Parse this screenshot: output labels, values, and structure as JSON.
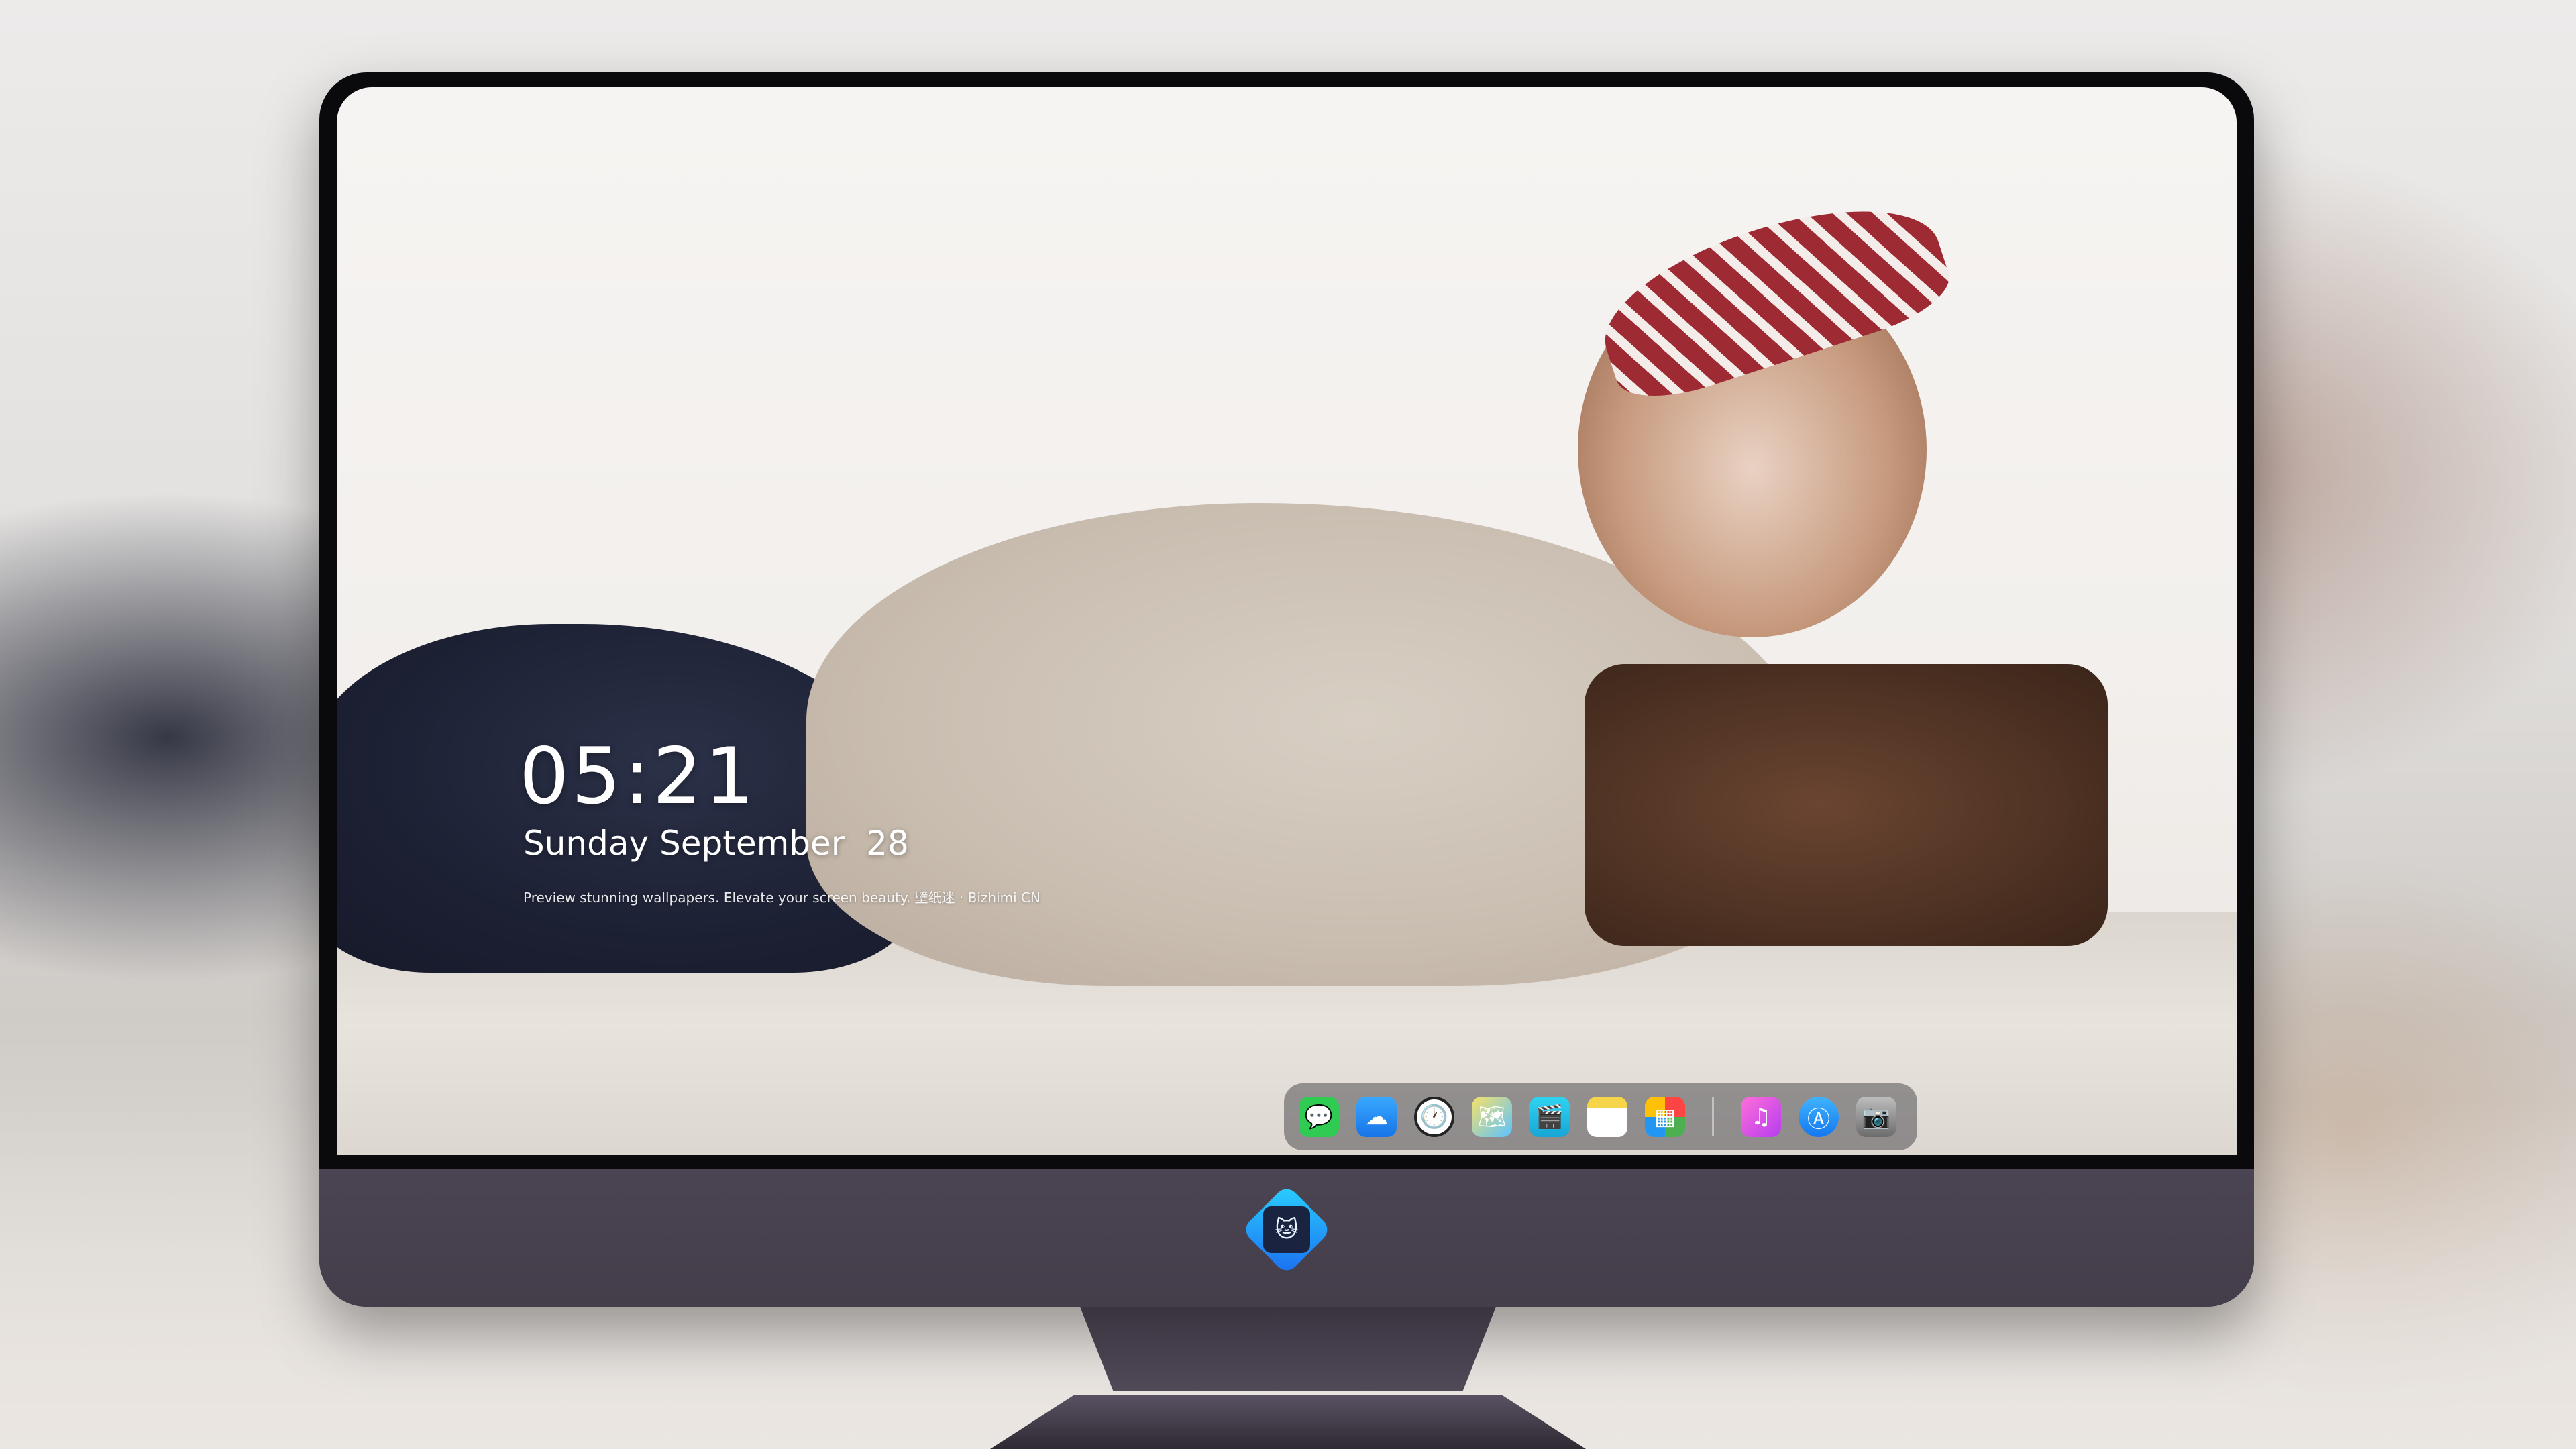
{
  "lockscreen": {
    "time": "05:21",
    "date": "Sunday September  28",
    "tagline": "Preview stunning wallpapers. Elevate your screen beauty. 壁纸迷 · Bizhimi CN"
  },
  "dock": {
    "items": [
      {
        "name": "messages",
        "glyph": "💬"
      },
      {
        "name": "weather",
        "glyph": "☁"
      },
      {
        "name": "clock",
        "glyph": "🕐"
      },
      {
        "name": "maps",
        "glyph": "🗺"
      },
      {
        "name": "videos",
        "glyph": "🎬"
      },
      {
        "name": "notes",
        "glyph": "≡"
      },
      {
        "name": "photos",
        "glyph": "▦"
      },
      {
        "name": "music",
        "glyph": "♫"
      },
      {
        "name": "app-store",
        "glyph": "Ⓐ"
      },
      {
        "name": "camera",
        "glyph": "📷"
      }
    ]
  },
  "brand": {
    "logo_glyph": "🐱",
    "accent": "#2ad0ff"
  }
}
